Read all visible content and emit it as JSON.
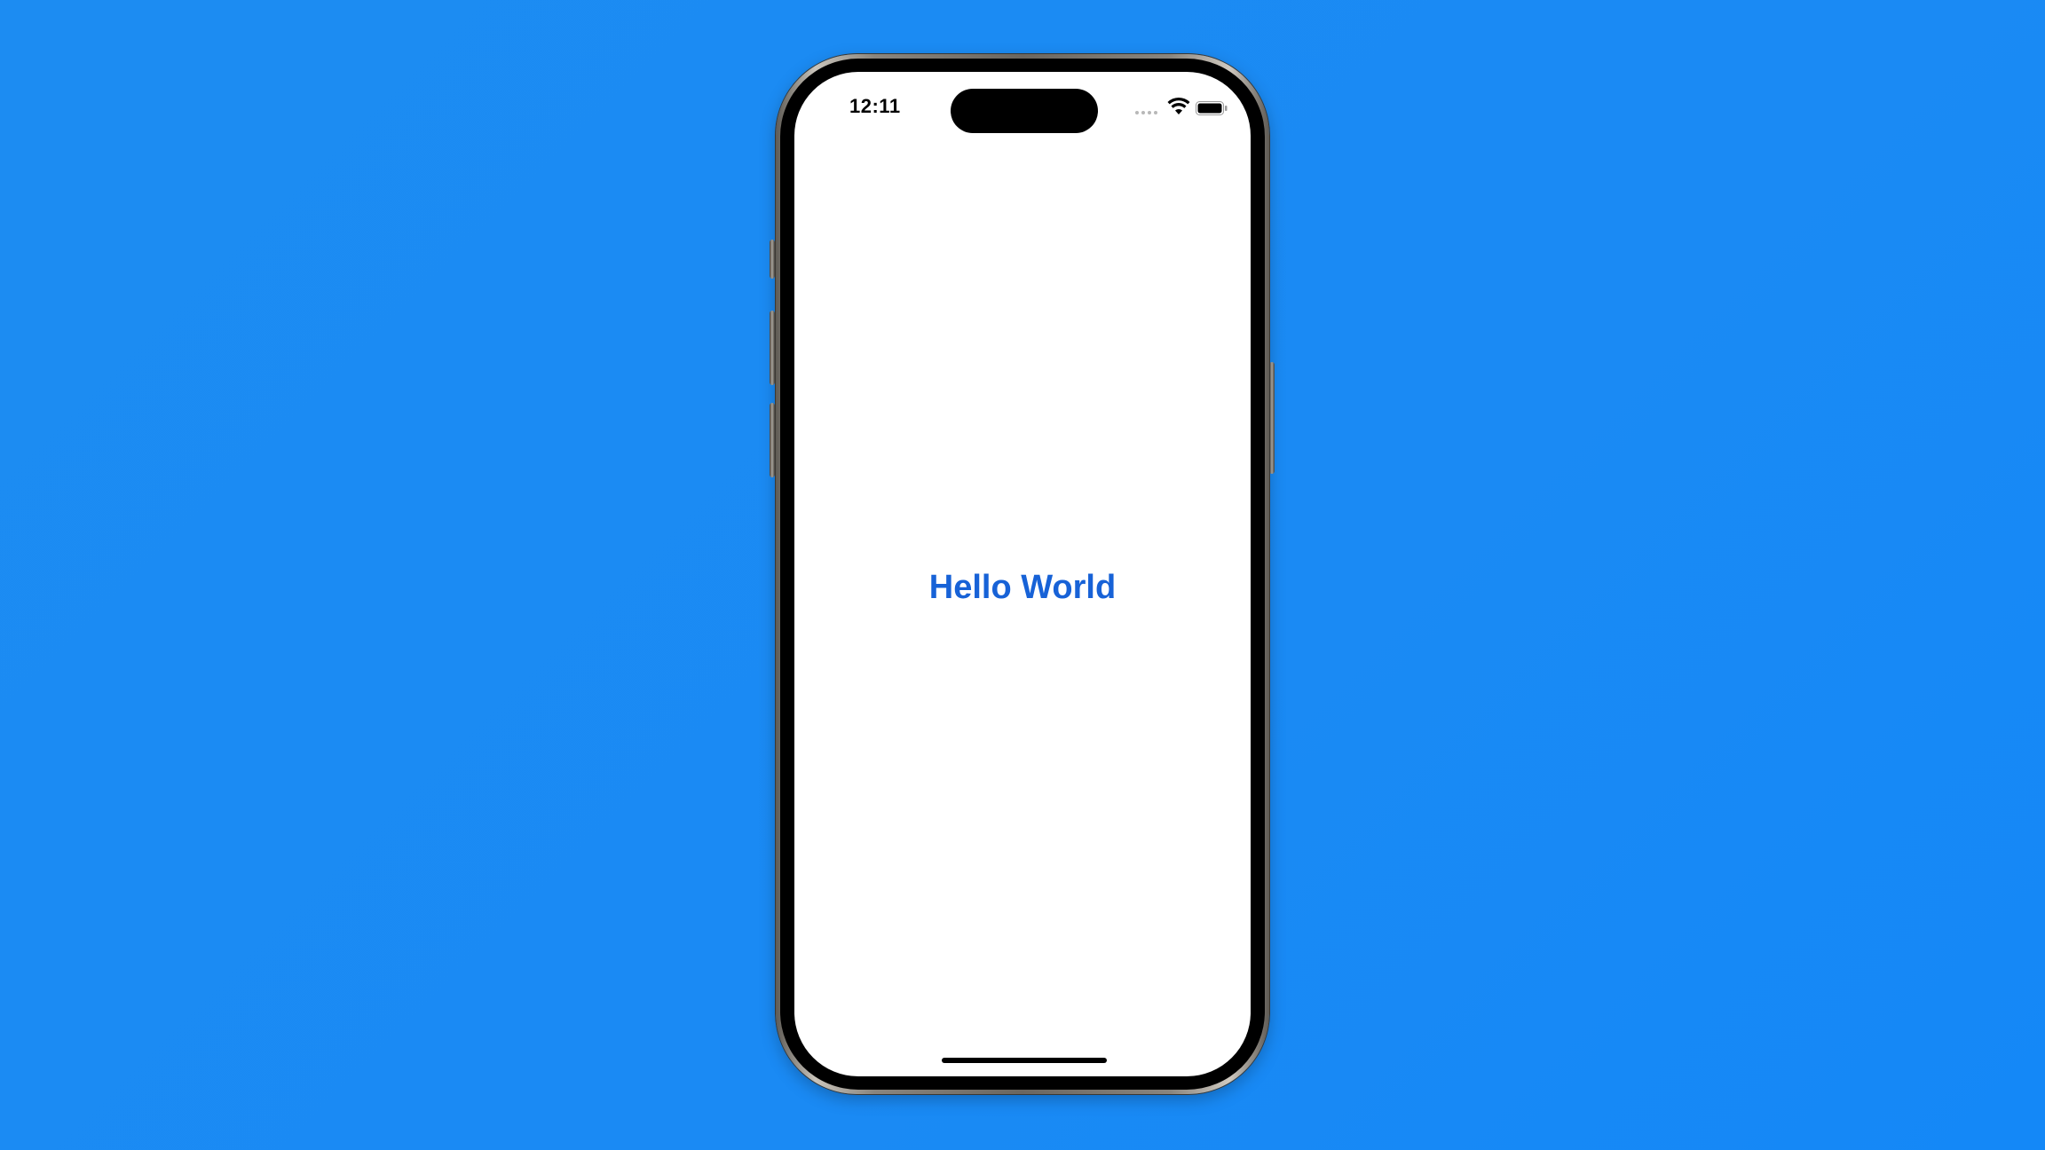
{
  "background_color": "#1a8af4",
  "status_bar": {
    "time": "12:11",
    "signal_icon": "cellular-signal-icon",
    "wifi_icon": "wifi-icon",
    "battery_icon": "battery-icon"
  },
  "screen": {
    "background_color": "#ffffff",
    "title": "Hello World",
    "title_color": "#1762d7"
  }
}
